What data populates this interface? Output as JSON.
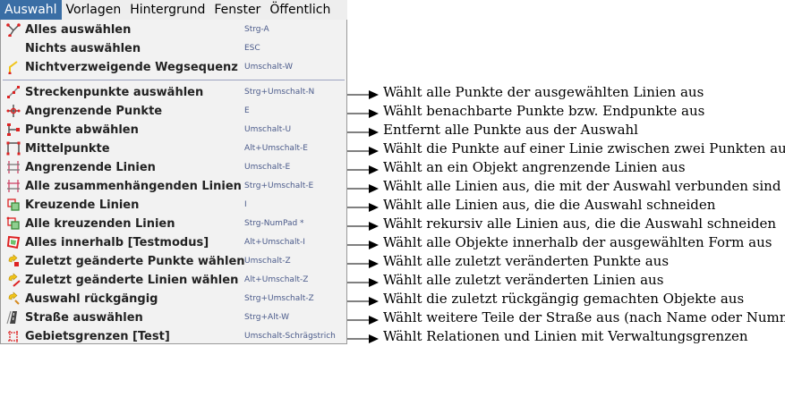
{
  "menubar": {
    "items": [
      "Auswahl",
      "Vorlagen",
      "Hintergrund",
      "Fenster",
      "Öffentlich"
    ]
  },
  "menu": {
    "group1": [
      {
        "label": "Alles auswählen",
        "shortcut": "Strg-A",
        "icon": "select-all-icon"
      },
      {
        "label": "Nichts auswählen",
        "shortcut": "ESC",
        "icon": ""
      },
      {
        "label": "Nichtverzweigende Wegsequenz",
        "shortcut": "Umschalt-W",
        "icon": "way-sequence-icon"
      }
    ],
    "group2": [
      {
        "label": "Streckenpunkte auswählen",
        "shortcut": "Strg+Umschalt-N",
        "icon": "way-nodes-icon"
      },
      {
        "label": "Angrenzende Punkte",
        "shortcut": "E",
        "icon": "adjacent-nodes-icon"
      },
      {
        "label": "Punkte abwählen",
        "shortcut": "Umschalt-U",
        "icon": "unselect-nodes-icon"
      },
      {
        "label": "Mittelpunkte",
        "shortcut": "Alt+Umschalt-E",
        "icon": "middle-nodes-icon"
      },
      {
        "label": "Angrenzende Linien",
        "shortcut": "Umschalt-E",
        "icon": "adjacent-ways-icon"
      },
      {
        "label": "Alle zusammenhängenden Linien",
        "shortcut": "Strg+Umschalt-E",
        "icon": "connected-ways-icon"
      },
      {
        "label": "Kreuzende Linien",
        "shortcut": "I",
        "icon": "intersecting-ways-icon"
      },
      {
        "label": "Alle kreuzenden Linien",
        "shortcut": "Strg-NumPad *",
        "icon": "all-intersecting-ways-icon"
      },
      {
        "label": "Alles innerhalb [Testmodus]",
        "shortcut": "Alt+Umschalt-I",
        "icon": "inside-icon"
      },
      {
        "label": "Zuletzt geänderte Punkte wählen",
        "shortcut": "Umschalt-Z",
        "icon": "last-modified-nodes-icon"
      },
      {
        "label": "Zuletzt geänderte Linien wählen",
        "shortcut": "Alt+Umschalt-Z",
        "icon": "last-modified-ways-icon"
      },
      {
        "label": "Auswahl rückgängig",
        "shortcut": "Strg+Umschalt-Z",
        "icon": "undo-selection-icon"
      },
      {
        "label": "Straße auswählen",
        "shortcut": "Strg+Alt-W",
        "icon": "road-icon"
      },
      {
        "label": "Gebietsgrenzen [Test]",
        "shortcut": "Umschalt-Schrägstrich",
        "icon": "boundary-icon"
      }
    ]
  },
  "annotations": [
    "Wählt alle Punkte der ausgewählten Linien aus",
    "Wählt benachbarte Punkte bzw. Endpunkte aus",
    "Entfernt alle Punkte aus der Auswahl",
    "Wählt die Punkte auf einer Linie zwischen zwei Punkten aus",
    "Wählt an ein Objekt angrenzende Linien aus",
    "Wählt alle Linien aus, die mit der Auswahl verbunden sind",
    "Wählt alle Linien aus, die die Auswahl schneiden",
    "Wählt rekursiv alle Linien aus, die die Auswahl schneiden",
    "Wählt alle Objekte innerhalb der ausgewählten Form aus",
    "Wählt alle zuletzt veränderten Punkte aus",
    "Wählt alle zuletzt veränderten Linien aus",
    "Wählt die zuletzt rückgängig gemachten Objekte aus",
    "Wählt weitere Teile der Straße aus (nach Name oder Nummer)",
    "Wählt Relationen und Linien mit Verwaltungsgrenzen"
  ],
  "colors": {
    "menubar_active_bg": "#3a6ea5",
    "menu_bg": "#f2f2f2",
    "shortcut_text": "#4a5a8a",
    "icon_red": "#d22",
    "icon_orange": "#d58a1e",
    "icon_yellow": "#f0c419"
  }
}
